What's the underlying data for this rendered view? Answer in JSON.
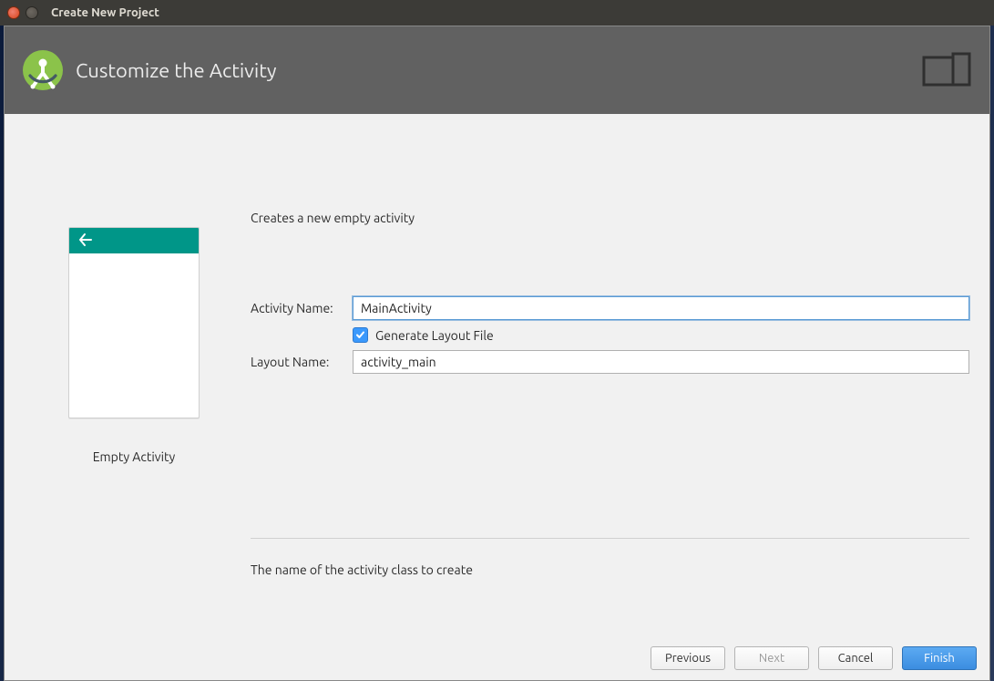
{
  "window": {
    "title": "Create New Project"
  },
  "header": {
    "title": "Customize the Activity"
  },
  "preview": {
    "caption": "Empty Activity"
  },
  "form": {
    "description": "Creates a new empty activity",
    "activity_name_label": "Activity Name:",
    "activity_name_value": "MainActivity",
    "generate_layout_label": "Generate Layout File",
    "generate_layout_checked": true,
    "layout_name_label": "Layout Name:",
    "layout_name_value": "activity_main",
    "hint": "The name of the activity class to create"
  },
  "footer": {
    "previous": "Previous",
    "next": "Next",
    "cancel": "Cancel",
    "finish": "Finish"
  }
}
